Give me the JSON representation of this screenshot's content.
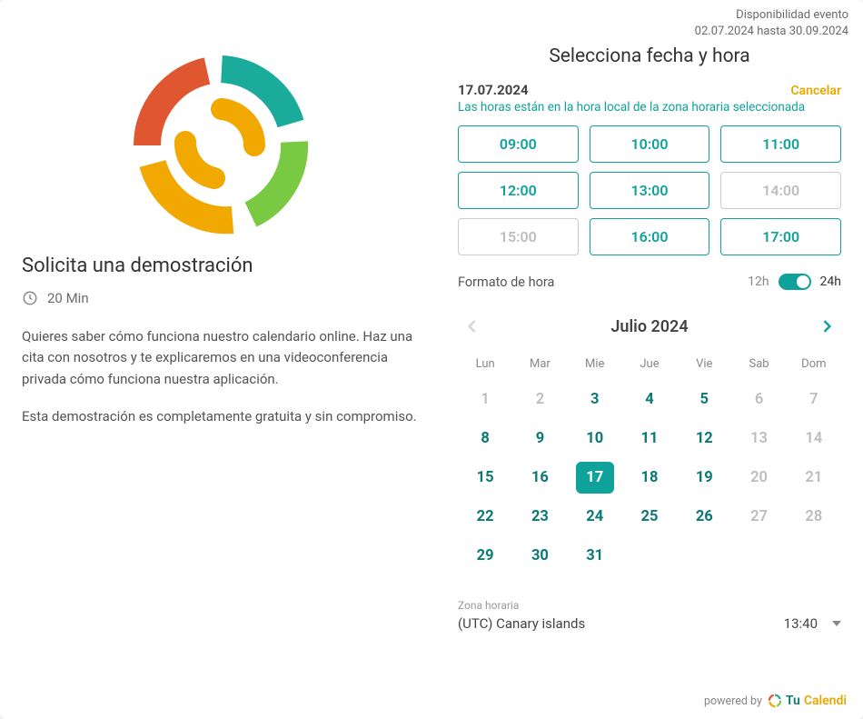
{
  "availability": {
    "label": "Disponibilidad evento",
    "range": "02.07.2024 hasta 30.09.2024"
  },
  "left": {
    "title": "Solicita una demostración",
    "duration": "20 Min",
    "desc1": "Quieres saber cómo funciona nuestro calendario online. Haz una cita con nosotros y te explicaremos en una videoconferencia privada cómo funciona nuestra aplicación.",
    "desc2": "Esta demostración es completamente gratuita y sin compromiso."
  },
  "right": {
    "title": "Selecciona fecha y hora",
    "selected_date": "17.07.2024",
    "cancel": "Cancelar",
    "tz_note": "Las horas están en la hora local de la zona horaria seleccionada",
    "slots": [
      {
        "t": "09:00",
        "enabled": true
      },
      {
        "t": "10:00",
        "enabled": true
      },
      {
        "t": "11:00",
        "enabled": true
      },
      {
        "t": "12:00",
        "enabled": true
      },
      {
        "t": "13:00",
        "enabled": true
      },
      {
        "t": "14:00",
        "enabled": false
      },
      {
        "t": "15:00",
        "enabled": false
      },
      {
        "t": "16:00",
        "enabled": true
      },
      {
        "t": "17:00",
        "enabled": true
      }
    ],
    "format_label": "Formato de hora",
    "fmt_12": "12h",
    "fmt_24": "24h",
    "month": "Julio 2024",
    "dows": [
      "Lun",
      "Mar",
      "Mie",
      "Jue",
      "Vie",
      "Sab",
      "Dom"
    ],
    "days": [
      {
        "n": "1",
        "state": "dim"
      },
      {
        "n": "2",
        "state": "dim"
      },
      {
        "n": "3",
        "state": "avail"
      },
      {
        "n": "4",
        "state": "avail"
      },
      {
        "n": "5",
        "state": "avail"
      },
      {
        "n": "6",
        "state": "dim"
      },
      {
        "n": "7",
        "state": "dim"
      },
      {
        "n": "8",
        "state": "avail"
      },
      {
        "n": "9",
        "state": "avail"
      },
      {
        "n": "10",
        "state": "avail"
      },
      {
        "n": "11",
        "state": "avail"
      },
      {
        "n": "12",
        "state": "avail"
      },
      {
        "n": "13",
        "state": "dim"
      },
      {
        "n": "14",
        "state": "dim"
      },
      {
        "n": "15",
        "state": "avail"
      },
      {
        "n": "16",
        "state": "avail"
      },
      {
        "n": "17",
        "state": "selected"
      },
      {
        "n": "18",
        "state": "avail"
      },
      {
        "n": "19",
        "state": "avail"
      },
      {
        "n": "20",
        "state": "dim"
      },
      {
        "n": "21",
        "state": "dim"
      },
      {
        "n": "22",
        "state": "avail"
      },
      {
        "n": "23",
        "state": "avail"
      },
      {
        "n": "24",
        "state": "avail"
      },
      {
        "n": "25",
        "state": "avail"
      },
      {
        "n": "26",
        "state": "avail"
      },
      {
        "n": "27",
        "state": "dim"
      },
      {
        "n": "28",
        "state": "dim"
      },
      {
        "n": "29",
        "state": "avail"
      },
      {
        "n": "30",
        "state": "avail"
      },
      {
        "n": "31",
        "state": "avail"
      }
    ],
    "tz_label": "Zona horaria",
    "tz_name": "(UTC) Canary islands",
    "tz_time": "13:40"
  },
  "footer": {
    "powered": "powered by",
    "brand_tu": "Tu",
    "brand_cal": "Calendi"
  }
}
